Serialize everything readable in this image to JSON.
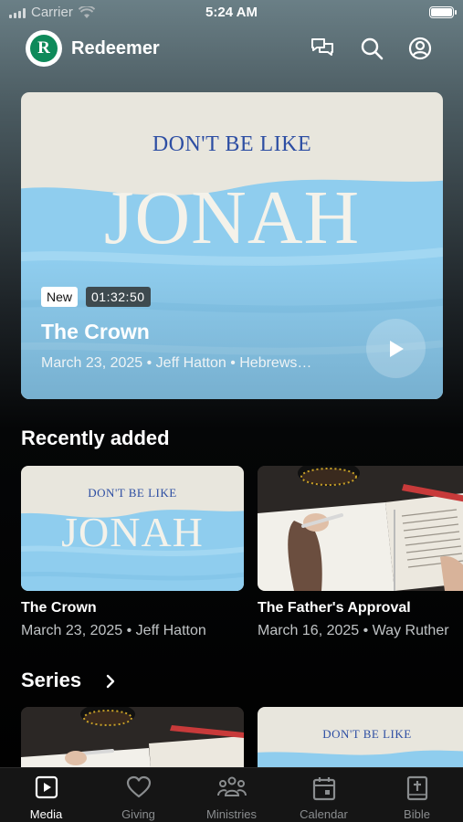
{
  "status_bar": {
    "carrier": "Carrier",
    "time": "5:24 AM"
  },
  "header": {
    "logo_letter": "R",
    "title": "Redeemer"
  },
  "hero": {
    "art_line1": "DON'T BE LIKE",
    "art_line2": "JONAH",
    "badge_new": "New",
    "duration": "01:32:50",
    "title": "The Crown",
    "meta": "March 23, 2025 • Jeff Hatton • Hebrews…"
  },
  "recently_added": {
    "heading": "Recently added",
    "items": [
      {
        "title": "The Crown",
        "meta": "March 23, 2025 • Jeff Hatton",
        "art_line1": "DON'T BE LIKE",
        "art_line2": "JONAH"
      },
      {
        "title": "The Father's Approval",
        "meta": "March 16, 2025 • Way Ruther"
      }
    ]
  },
  "series": {
    "heading": "Series",
    "items": [
      {
        "art_line1": "DON'T BE LIKE"
      }
    ]
  },
  "tabs": [
    {
      "label": "Media",
      "icon": "play-square-icon",
      "active": true
    },
    {
      "label": "Giving",
      "icon": "heart-icon",
      "active": false
    },
    {
      "label": "Ministries",
      "icon": "people-icon",
      "active": false
    },
    {
      "label": "Calendar",
      "icon": "calendar-icon",
      "active": false
    },
    {
      "label": "Bible",
      "icon": "bible-icon",
      "active": false
    }
  ],
  "colors": {
    "brand_green": "#0e8a5a",
    "art_blue": "#2d4ea3",
    "wave_blue": "#8fcdee"
  }
}
